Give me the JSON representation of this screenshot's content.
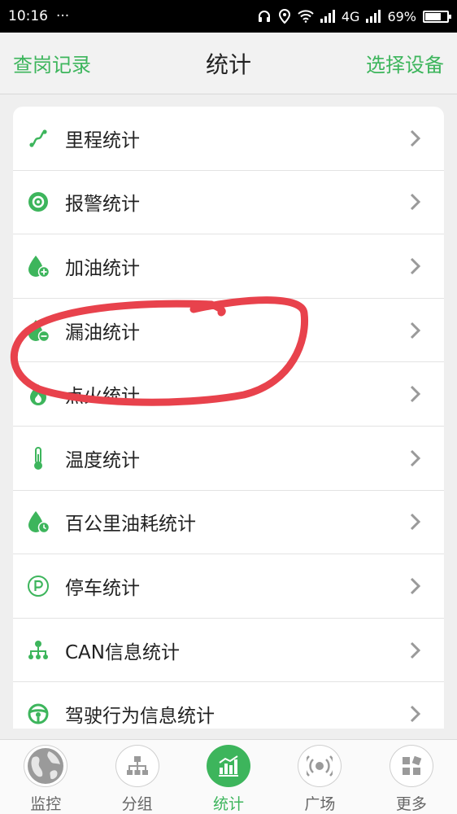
{
  "status_bar": {
    "time": "10:16",
    "dots": "···",
    "network": "4G",
    "battery": "69%"
  },
  "header": {
    "left_link": "查岗记录",
    "title": "统计",
    "right_link": "选择设备"
  },
  "colors": {
    "accent": "#3db55c",
    "annotation": "#e8424c"
  },
  "list": {
    "items": [
      {
        "label": "里程统计",
        "icon": "route-icon"
      },
      {
        "label": "报警统计",
        "icon": "alarm-icon"
      },
      {
        "label": "加油统计",
        "icon": "refuel-icon"
      },
      {
        "label": "漏油统计",
        "icon": "oil-leak-icon"
      },
      {
        "label": "点火统计",
        "icon": "ignition-icon"
      },
      {
        "label": "温度统计",
        "icon": "thermometer-icon"
      },
      {
        "label": "百公里油耗统计",
        "icon": "fuel-consumption-icon"
      },
      {
        "label": "停车统计",
        "icon": "parking-icon"
      },
      {
        "label": "CAN信息统计",
        "icon": "network-tree-icon"
      },
      {
        "label": "驾驶行为信息统计",
        "icon": "steering-wheel-icon"
      }
    ]
  },
  "nav": {
    "items": [
      {
        "label": "监控",
        "icon": "globe-icon"
      },
      {
        "label": "分组",
        "icon": "org-chart-icon"
      },
      {
        "label": "统计",
        "icon": "bar-chart-icon"
      },
      {
        "label": "广场",
        "icon": "broadcast-icon"
      },
      {
        "label": "更多",
        "icon": "grid-icon"
      }
    ]
  }
}
